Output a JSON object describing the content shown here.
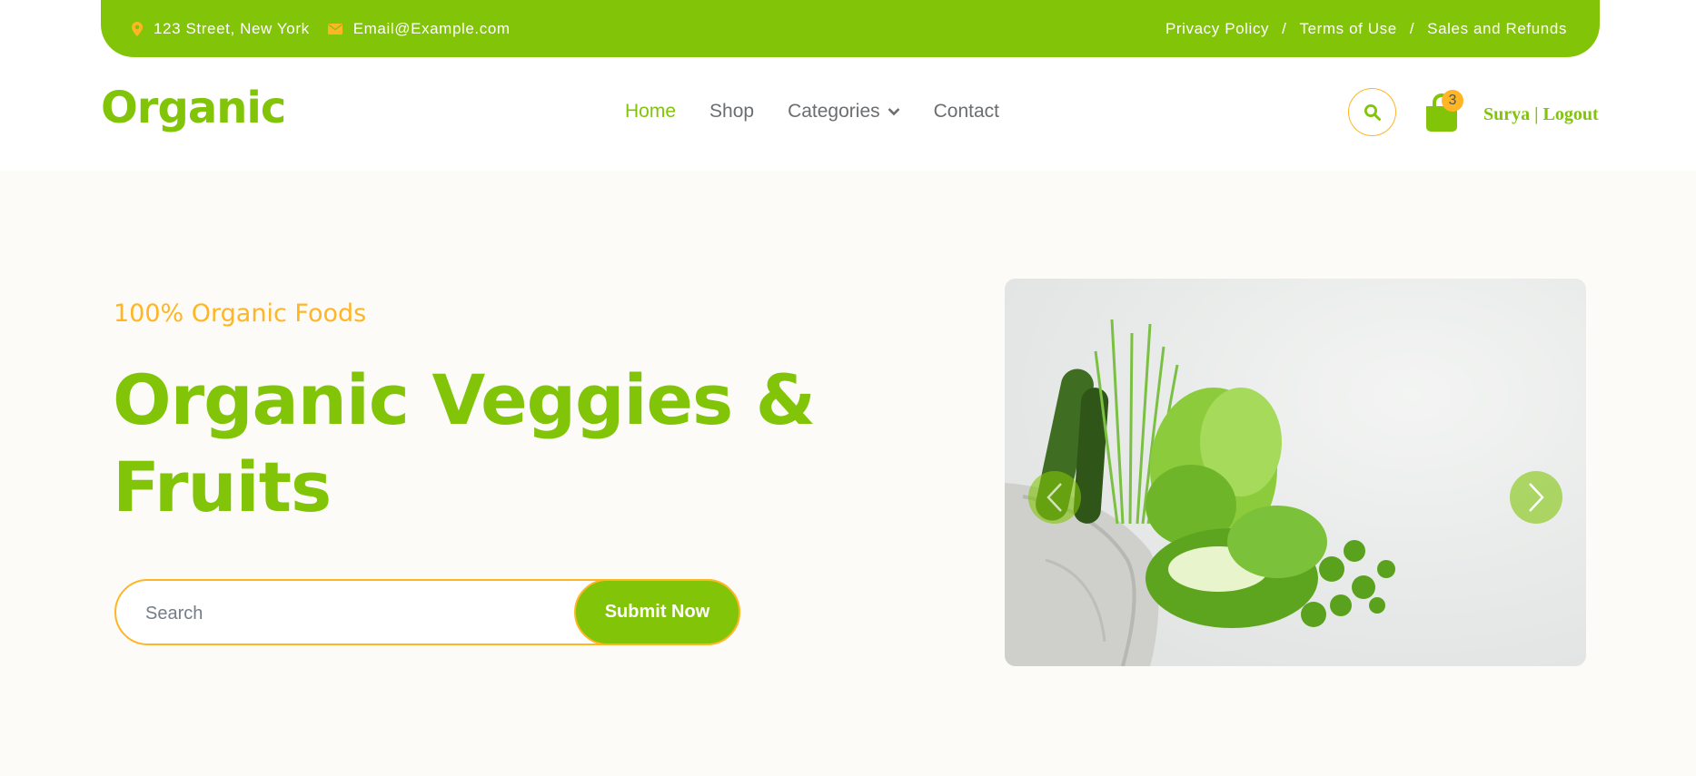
{
  "topbar": {
    "address": "123 Street, New York",
    "email": "Email@Example.com",
    "links": [
      "Privacy Policy",
      "Terms of Use",
      "Sales and Refunds"
    ],
    "separator": "/"
  },
  "header": {
    "logo": "Organic",
    "nav": [
      {
        "label": "Home",
        "active": true
      },
      {
        "label": "Shop",
        "active": false
      },
      {
        "label": "Categories",
        "active": false
      },
      {
        "label": "Contact",
        "active": false
      }
    ],
    "cart_count": "3",
    "user_label": "Surya | Logout"
  },
  "hero": {
    "kicker": "100% Organic Foods",
    "headline_line1": "Organic Veggies &",
    "headline_line2": "Fruits",
    "search_placeholder": "Search",
    "submit_label": "Submit Now"
  },
  "colors": {
    "primary": "#81c408",
    "accent": "#ffb524",
    "text": "#45595b",
    "hero_bg": "#fcfbf7"
  },
  "icons": [
    "map-marker-icon",
    "envelope-icon",
    "chevron-down-icon",
    "search-icon",
    "shopping-bag-icon",
    "chevron-left-icon",
    "chevron-right-icon"
  ]
}
